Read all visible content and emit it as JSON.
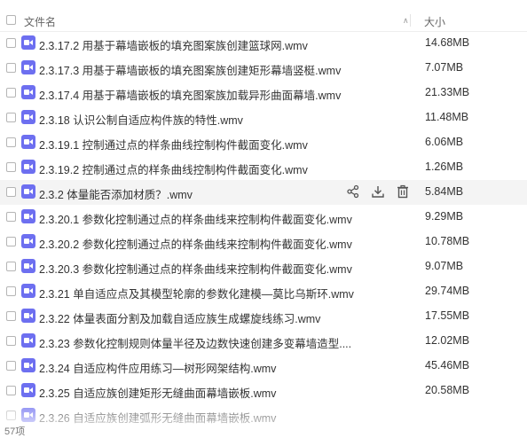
{
  "header": {
    "name_label": "文件名",
    "size_label": "大小",
    "sort_icon": "sort-caret-up-icon"
  },
  "files": [
    {
      "name": "2.3.17.2 用基于幕墙嵌板的填充图案族创建篮球网.wmv",
      "size": "14.68MB"
    },
    {
      "name": "2.3.17.3 用基于幕墙嵌板的填充图案族创建矩形幕墙竖梃.wmv",
      "size": "7.07MB"
    },
    {
      "name": "2.3.17.4 用基于幕墙嵌板的填充图案族加载异形曲面幕墙.wmv",
      "size": "21.33MB"
    },
    {
      "name": "2.3.18 认识公制自适应构件族的特性.wmv",
      "size": "11.48MB"
    },
    {
      "name": "2.3.19.1 控制通过点的样条曲线控制构件截面变化.wmv",
      "size": "6.06MB"
    },
    {
      "name": "2.3.19.2 控制通过点的样条曲线控制构件截面变化.wmv",
      "size": "1.26MB"
    },
    {
      "name": "2.3.2 体量能否添加材质？.wmv",
      "size": "5.84MB"
    },
    {
      "name": "2.3.20.1 参数化控制通过点的样条曲线来控制构件截面变化.wmv",
      "size": "9.29MB"
    },
    {
      "name": "2.3.20.2 参数化控制通过点的样条曲线来控制构件截面变化.wmv",
      "size": "10.78MB"
    },
    {
      "name": "2.3.20.3 参数化控制通过点的样条曲线来控制构件截面变化.wmv",
      "size": "9.07MB"
    },
    {
      "name": "2.3.21 单自适应点及其模型轮廓的参数化建模—莫比乌斯环.wmv",
      "size": "29.74MB"
    },
    {
      "name": "2.3.22 体量表面分割及加载自适应族生成螺旋线练习.wmv",
      "size": "17.55MB"
    },
    {
      "name": "2.3.23 参数化控制规则体量半径及边数快速创建多变幕墙造型....",
      "size": "12.02MB"
    },
    {
      "name": "2.3.24 自适应构件应用练习—树形网架结构.wmv",
      "size": "45.46MB"
    },
    {
      "name": "2.3.25 自适应族创建矩形无缝曲面幕墙嵌板.wmv",
      "size": "20.58MB"
    },
    {
      "name": "2.3.26 自适应族创建弧形无缝曲面幕墙嵌板.wmv",
      "size": ""
    }
  ],
  "row_actions": {
    "share_icon": "share-icon",
    "download_icon": "download-icon",
    "delete_icon": "trash-icon"
  },
  "file_icon": "video-file-icon",
  "footer": {
    "count_text": "57项"
  },
  "colors": {
    "file_icon": "#6d6ff0",
    "hover_row": "#f4f4f4"
  }
}
